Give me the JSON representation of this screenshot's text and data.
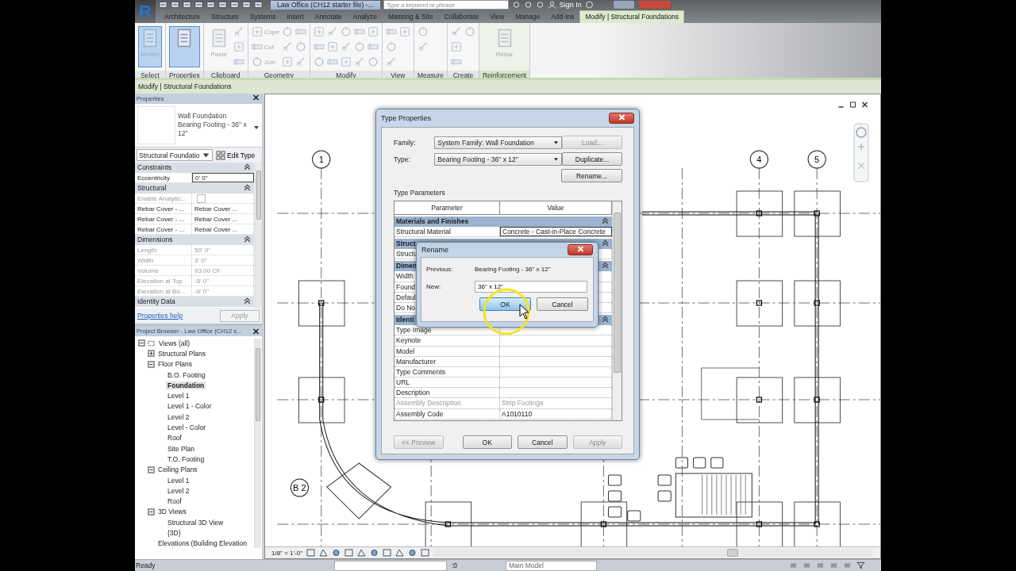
{
  "title_bar": {
    "logo": "R",
    "document_title": "Law Office (CH12 starter file) -...",
    "search": {
      "placeholder": "Type a keyword or phrase"
    },
    "sign_in": "Sign In"
  },
  "tabs": [
    {
      "label": "Architecture",
      "selected": false
    },
    {
      "label": "Structure",
      "selected": false
    },
    {
      "label": "Systems",
      "selected": false
    },
    {
      "label": "Insert",
      "selected": false
    },
    {
      "label": "Annotate",
      "selected": false
    },
    {
      "label": "Analyze",
      "selected": false
    },
    {
      "label": "Massing & Site",
      "selected": false
    },
    {
      "label": "Collaborate",
      "selected": false
    },
    {
      "label": "View",
      "selected": false
    },
    {
      "label": "Manage",
      "selected": false
    },
    {
      "label": "Add-Ins",
      "selected": false
    },
    {
      "label": "Modify | Structural Foundations",
      "selected": true
    }
  ],
  "ribbon": {
    "panels": [
      {
        "label": "Select",
        "tools": [
          {
            "kind": "large",
            "label": "Modify",
            "selected": true,
            "disabled": true
          }
        ]
      },
      {
        "label": "Properties",
        "tools": [
          {
            "kind": "large",
            "selected": true,
            "disabled": false
          }
        ]
      },
      {
        "label": "Clipboard",
        "tools": [
          {
            "kind": "large",
            "label": "Paste",
            "selected": false,
            "disabled": true
          },
          {
            "kind": "icon",
            "selected": false,
            "disabled": true
          },
          {
            "kind": "icon",
            "selected": false,
            "disabled": true
          },
          {
            "kind": "icon",
            "selected": false,
            "disabled": true
          }
        ]
      },
      {
        "label": "Geometry",
        "tools": [
          {
            "kind": "small",
            "label": "Cope",
            "selected": false,
            "disabled": true
          },
          {
            "kind": "small",
            "label": "Cut",
            "selected": false,
            "disabled": true
          },
          {
            "kind": "small",
            "label": "Join",
            "selected": false,
            "disabled": true
          },
          {
            "kind": "icon",
            "selected": false,
            "disabled": true
          },
          {
            "kind": "icon",
            "selected": false,
            "disabled": true
          },
          {
            "kind": "icon",
            "selected": false,
            "disabled": true
          },
          {
            "kind": "icon",
            "selected": false,
            "disabled": true
          },
          {
            "kind": "icon",
            "selected": false,
            "disabled": true
          },
          {
            "kind": "icon",
            "selected": false,
            "disabled": true
          }
        ]
      },
      {
        "label": "Modify",
        "tools": [
          {
            "kind": "icon",
            "selected": false,
            "disabled": true
          },
          {
            "kind": "icon",
            "selected": false,
            "disabled": true
          },
          {
            "kind": "icon",
            "selected": false,
            "disabled": true
          },
          {
            "kind": "icon",
            "selected": false,
            "disabled": true
          },
          {
            "kind": "icon",
            "selected": false,
            "disabled": true
          },
          {
            "kind": "icon",
            "selected": false,
            "disabled": true
          },
          {
            "kind": "icon",
            "selected": false,
            "disabled": true
          },
          {
            "kind": "icon",
            "selected": false,
            "disabled": true
          },
          {
            "kind": "icon",
            "selected": false,
            "disabled": true
          },
          {
            "kind": "icon",
            "selected": false,
            "disabled": true
          },
          {
            "kind": "icon",
            "selected": false,
            "disabled": true
          },
          {
            "kind": "icon",
            "selected": false,
            "disabled": true
          },
          {
            "kind": "icon",
            "selected": false,
            "disabled": true
          },
          {
            "kind": "icon",
            "selected": false,
            "disabled": true
          },
          {
            "kind": "icon",
            "selected": false,
            "disabled": true
          }
        ]
      },
      {
        "label": "View",
        "tools": [
          {
            "kind": "icon",
            "selected": false,
            "disabled": true
          },
          {
            "kind": "icon",
            "selected": false,
            "disabled": true
          },
          {
            "kind": "icon",
            "selected": false,
            "disabled": true
          },
          {
            "kind": "icon",
            "selected": false,
            "disabled": true
          }
        ]
      },
      {
        "label": "Measure",
        "tools": [
          {
            "kind": "icon",
            "selected": false,
            "disabled": true
          },
          {
            "kind": "icon",
            "selected": false,
            "disabled": true
          }
        ]
      },
      {
        "label": "Create",
        "tools": [
          {
            "kind": "icon",
            "selected": false,
            "disabled": true
          },
          {
            "kind": "icon",
            "selected": false,
            "disabled": true
          },
          {
            "kind": "icon",
            "selected": false,
            "disabled": true
          },
          {
            "kind": "icon",
            "selected": false,
            "disabled": true
          }
        ]
      },
      {
        "label": "Reinforcement",
        "tools": [
          {
            "kind": "large",
            "label": "Rebar",
            "selected": false,
            "disabled": true
          }
        ]
      }
    ]
  },
  "options_bar": {
    "context": "Modify | Structural Foundations"
  },
  "properties": {
    "title": "Properties",
    "type_family": "Wall Foundation",
    "type_name": "Bearing Footing - 36\" x 12\"",
    "category": "Structural Foundatio",
    "edit_type": "Edit Type",
    "groups": [
      {
        "name": "Constraints",
        "rows": [
          {
            "kind": "field",
            "label": "Eccentricity",
            "value": "0' 0\"",
            "disabled": false
          }
        ]
      },
      {
        "name": "Structural",
        "rows": [
          {
            "kind": "checkbox",
            "label": "Enable Analytic...",
            "checked": false,
            "disabled": true
          },
          {
            "kind": "text",
            "label": "Rebar Cover - ...",
            "value": "Rebar Cover ...",
            "disabled": false
          },
          {
            "kind": "text",
            "label": "Rebar Cover - ...",
            "value": "Rebar Cover ...",
            "disabled": false
          },
          {
            "kind": "text",
            "label": "Rebar Cover - ...",
            "value": "Rebar Cover ...",
            "disabled": false
          }
        ]
      },
      {
        "name": "Dimensions",
        "rows": [
          {
            "kind": "text",
            "label": "Length",
            "value": "50' 0\"",
            "disabled": true
          },
          {
            "kind": "text",
            "label": "Width",
            "value": "3' 0\"",
            "disabled": true
          },
          {
            "kind": "text",
            "label": "Volume",
            "value": "93.00 CF",
            "disabled": true
          },
          {
            "kind": "text",
            "label": "Elevation at Top",
            "value": "-5' 0\"",
            "disabled": true
          },
          {
            "kind": "text",
            "label": "Elevation at Bo...",
            "value": "-6' 0\"",
            "disabled": true
          }
        ]
      },
      {
        "name": "Identity Data"
      }
    ],
    "help": "Properties help",
    "apply": {
      "label": "Apply",
      "disabled": true
    }
  },
  "project_browser": {
    "title": "Project Browser - Law Office (CH12 s...",
    "tree": [
      {
        "label": "Views (all)",
        "expanded": true,
        "selected": false,
        "children": [
          {
            "label": "Structural Plans",
            "expanded": false,
            "selected": false
          },
          {
            "label": "Floor Plans",
            "expanded": true,
            "selected": false,
            "children": [
              {
                "label": "B.O. Footing",
                "selected": false
              },
              {
                "label": "Foundation",
                "selected": true
              },
              {
                "label": "Level 1",
                "selected": false
              },
              {
                "label": "Level 1 - Color",
                "selected": false
              },
              {
                "label": "Level 2",
                "selected": false
              },
              {
                "label": "Level - Color",
                "selected": false
              },
              {
                "label": "Roof",
                "selected": false
              },
              {
                "label": "Site Plan",
                "selected": false
              },
              {
                "label": "T.O. Footing",
                "selected": false
              }
            ]
          },
          {
            "label": "Ceiling Plans",
            "expanded": true,
            "selected": false,
            "children": [
              {
                "label": "Level 1",
                "selected": false
              },
              {
                "label": "Level 2",
                "selected": false
              },
              {
                "label": "Roof",
                "selected": false
              }
            ]
          },
          {
            "label": "3D Views",
            "expanded": true,
            "selected": false,
            "children": [
              {
                "label": "Structural 3D View",
                "selected": false
              },
              {
                "label": "{3D}",
                "selected": false
              }
            ]
          },
          {
            "label": "Elevations (Building Elevation",
            "selected": false
          }
        ]
      }
    ]
  },
  "view": {
    "grid_labels": [
      {
        "label": "1"
      },
      {
        "label": "4"
      },
      {
        "label": "5"
      },
      {
        "label": "B 2"
      }
    ],
    "scale": "1/8\" = 1'-0\""
  },
  "type_properties": {
    "title": "Type Properties",
    "family": {
      "label": "Family:",
      "value": "System Family: Wall Foundation"
    },
    "type": {
      "label": "Type:",
      "value": "Bearing Footing - 36\" x 12\""
    },
    "side_buttons": [
      {
        "label": "Load...",
        "disabled": true
      },
      {
        "label": "Duplicate...",
        "disabled": false
      },
      {
        "label": "Rename...",
        "disabled": false
      }
    ],
    "section": "Type Parameters",
    "columns": [
      "Parameter",
      "Value"
    ],
    "groups": [
      {
        "name": "Materials and Finishes",
        "rows": [
          {
            "kind": "field",
            "parameter": "Structural Material",
            "value": "Concrete - Cast-in-Place Concrete",
            "disabled": false
          }
        ]
      },
      {
        "name": "Struct",
        "rows": [
          {
            "kind": "text",
            "parameter": "Structu",
            "disabled": false
          }
        ]
      },
      {
        "name": "Dimen",
        "rows": [
          {
            "kind": "text",
            "parameter": "Width",
            "disabled": false
          },
          {
            "kind": "text",
            "parameter": "Found",
            "disabled": false
          },
          {
            "kind": "text",
            "parameter": "Defaul",
            "disabled": false
          },
          {
            "kind": "text",
            "parameter": "Do No",
            "disabled": false
          }
        ]
      },
      {
        "name": "Identi",
        "rows": [
          {
            "kind": "text",
            "parameter": "Type Image",
            "disabled": false
          },
          {
            "kind": "text",
            "parameter": "Keynote",
            "disabled": false
          },
          {
            "kind": "text",
            "parameter": "Model",
            "disabled": false
          },
          {
            "kind": "text",
            "parameter": "Manufacturer",
            "disabled": false
          },
          {
            "kind": "text",
            "parameter": "Type Comments",
            "disabled": false
          },
          {
            "kind": "text",
            "parameter": "URL",
            "disabled": false
          },
          {
            "kind": "text",
            "parameter": "Description",
            "disabled": false
          },
          {
            "kind": "text",
            "parameter": "Assembly Description",
            "value": "Strip Footings",
            "disabled": true
          },
          {
            "kind": "text",
            "parameter": "Assembly Code",
            "value": "A1010110",
            "disabled": false
          }
        ]
      }
    ],
    "buttons": [
      {
        "label": "<< Preview",
        "disabled": true
      },
      {
        "label": "OK",
        "disabled": false
      },
      {
        "label": "Cancel",
        "disabled": false
      },
      {
        "label": "Apply",
        "disabled": true
      }
    ]
  },
  "rename_dialog": {
    "title": "Rename",
    "previous": {
      "label": "Previous:",
      "value": "Bearing Footing - 36\" x 12\""
    },
    "new": {
      "label": "New:",
      "value": "36\" x 12\""
    },
    "buttons": [
      {
        "label": "OK",
        "selected": true
      },
      {
        "label": "Cancel",
        "selected": false
      }
    ]
  },
  "status_bar": {
    "status": "Ready",
    "count": ":0",
    "model": "Main Model"
  }
}
